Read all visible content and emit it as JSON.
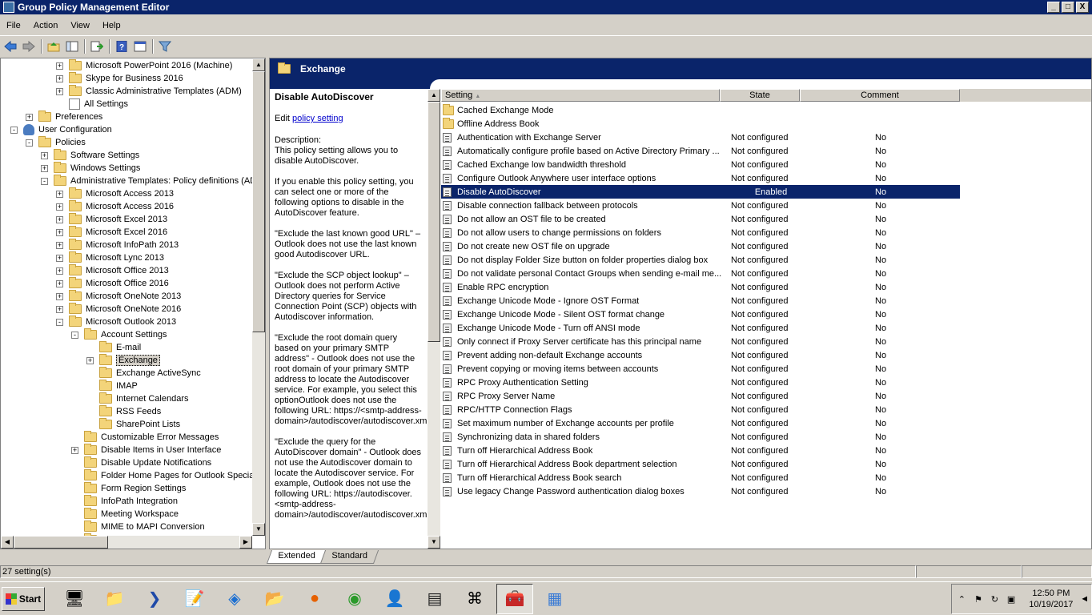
{
  "window": {
    "title": "Group Policy Management Editor",
    "min": "_",
    "max": "□",
    "close": "X"
  },
  "menu": [
    "File",
    "Action",
    "View",
    "Help"
  ],
  "toolbar": {
    "icons": [
      "back-arrow-icon",
      "forward-arrow-icon",
      "up-folder-icon",
      "show-hide-tree-icon",
      "export-list-icon",
      "help-icon",
      "properties-icon",
      "filter-icon"
    ]
  },
  "tree": [
    {
      "depth": 3,
      "exp": "+",
      "icon": "folder",
      "label": "Microsoft PowerPoint 2016 (Machine)"
    },
    {
      "depth": 3,
      "exp": "+",
      "icon": "folder",
      "label": "Skype for Business 2016"
    },
    {
      "depth": 3,
      "exp": "+",
      "icon": "folder",
      "label": "Classic Administrative Templates (ADM)"
    },
    {
      "depth": 3,
      "exp": "",
      "icon": "settings",
      "label": "All Settings"
    },
    {
      "depth": 1,
      "exp": "+",
      "icon": "folder",
      "label": "Preferences"
    },
    {
      "depth": 0,
      "exp": "-",
      "icon": "user",
      "label": "User Configuration"
    },
    {
      "depth": 1,
      "exp": "-",
      "icon": "folder",
      "label": "Policies"
    },
    {
      "depth": 2,
      "exp": "+",
      "icon": "folder",
      "label": "Software Settings"
    },
    {
      "depth": 2,
      "exp": "+",
      "icon": "folder",
      "label": "Windows Settings"
    },
    {
      "depth": 2,
      "exp": "-",
      "icon": "folder",
      "label": "Administrative Templates: Policy definitions (ADM"
    },
    {
      "depth": 3,
      "exp": "+",
      "icon": "folder",
      "label": "Microsoft Access 2013"
    },
    {
      "depth": 3,
      "exp": "+",
      "icon": "folder",
      "label": "Microsoft Access 2016"
    },
    {
      "depth": 3,
      "exp": "+",
      "icon": "folder",
      "label": "Microsoft Excel 2013"
    },
    {
      "depth": 3,
      "exp": "+",
      "icon": "folder",
      "label": "Microsoft Excel 2016"
    },
    {
      "depth": 3,
      "exp": "+",
      "icon": "folder",
      "label": "Microsoft InfoPath 2013"
    },
    {
      "depth": 3,
      "exp": "+",
      "icon": "folder",
      "label": "Microsoft Lync 2013"
    },
    {
      "depth": 3,
      "exp": "+",
      "icon": "folder",
      "label": "Microsoft Office 2013"
    },
    {
      "depth": 3,
      "exp": "+",
      "icon": "folder",
      "label": "Microsoft Office 2016"
    },
    {
      "depth": 3,
      "exp": "+",
      "icon": "folder",
      "label": "Microsoft OneNote 2013"
    },
    {
      "depth": 3,
      "exp": "+",
      "icon": "folder",
      "label": "Microsoft OneNote 2016"
    },
    {
      "depth": 3,
      "exp": "-",
      "icon": "folder",
      "label": "Microsoft Outlook 2013"
    },
    {
      "depth": 4,
      "exp": "-",
      "icon": "folder",
      "label": "Account Settings"
    },
    {
      "depth": 5,
      "exp": "",
      "icon": "folder",
      "label": "E-mail"
    },
    {
      "depth": 5,
      "exp": "+",
      "icon": "folder",
      "label": "Exchange",
      "selected": true
    },
    {
      "depth": 5,
      "exp": "",
      "icon": "folder",
      "label": "Exchange ActiveSync"
    },
    {
      "depth": 5,
      "exp": "",
      "icon": "folder",
      "label": "IMAP"
    },
    {
      "depth": 5,
      "exp": "",
      "icon": "folder",
      "label": "Internet Calendars"
    },
    {
      "depth": 5,
      "exp": "",
      "icon": "folder",
      "label": "RSS Feeds"
    },
    {
      "depth": 5,
      "exp": "",
      "icon": "folder",
      "label": "SharePoint Lists"
    },
    {
      "depth": 4,
      "exp": "",
      "icon": "folder",
      "label": "Customizable Error Messages"
    },
    {
      "depth": 4,
      "exp": "+",
      "icon": "folder",
      "label": "Disable Items in User Interface"
    },
    {
      "depth": 4,
      "exp": "",
      "icon": "folder",
      "label": "Disable Update Notifications"
    },
    {
      "depth": 4,
      "exp": "",
      "icon": "folder",
      "label": "Folder Home Pages for Outlook Special F"
    },
    {
      "depth": 4,
      "exp": "",
      "icon": "folder",
      "label": "Form Region Settings"
    },
    {
      "depth": 4,
      "exp": "",
      "icon": "folder",
      "label": "InfoPath Integration"
    },
    {
      "depth": 4,
      "exp": "",
      "icon": "folder",
      "label": "Meeting Workspace"
    },
    {
      "depth": 4,
      "exp": "",
      "icon": "folder",
      "label": "MIME to MAPI Conversion"
    },
    {
      "depth": 4,
      "exp": "+",
      "icon": "folder",
      "label": "Miscellaneous"
    }
  ],
  "right_header": {
    "title": "Exchange"
  },
  "description": {
    "title": "Disable AutoDiscover",
    "edit_prefix": "Edit ",
    "edit_link": "policy setting ",
    "paragraphs": [
      "Description:\nThis policy setting allows you to disable AutoDiscover.",
      "If you enable this policy setting, you can select one or more of the following options to disable in the AutoDiscover feature.",
      "\"Exclude the last known good URL\" – Outlook does not use the last known good Autodiscover URL.",
      "\"Exclude the SCP object lookup\" – Outlook does not perform Active Directory queries for Service Connection Point (SCP) objects with Autodiscover information.",
      "\"Exclude the root domain query based on your primary SMTP address\" - Outlook does not use the root domain of your primary SMTP address to locate the Autodiscover service. For example, you select this optionOutlook does not use the following URL: https://<smtp-address-domain>/autodiscover/autodiscover.xml.",
      "\"Exclude the query for the AutoDiscover domain\" - Outlook does not use the Autodiscover domain to locate the Autodiscover service. For example, Outlook does not use the following URL: https://autodiscover.<smtp-address-domain>/autodiscover/autodiscover.xml"
    ]
  },
  "list": {
    "columns": {
      "setting": "Setting",
      "state": "State",
      "comment": "Comment"
    },
    "rows": [
      {
        "type": "folder",
        "setting": "Cached Exchange Mode",
        "state": "",
        "comment": ""
      },
      {
        "type": "folder",
        "setting": "Offline Address Book",
        "state": "",
        "comment": ""
      },
      {
        "type": "policy",
        "setting": "Authentication with Exchange Server",
        "state": "Not configured",
        "comment": "No"
      },
      {
        "type": "policy",
        "setting": "Automatically configure profile based on Active Directory Primary ...",
        "state": "Not configured",
        "comment": "No"
      },
      {
        "type": "policy",
        "setting": "Cached Exchange low bandwidth threshold",
        "state": "Not configured",
        "comment": "No"
      },
      {
        "type": "policy",
        "setting": "Configure Outlook Anywhere user interface options",
        "state": "Not configured",
        "comment": "No"
      },
      {
        "type": "policy",
        "setting": "Disable AutoDiscover",
        "state": "Enabled",
        "comment": "No",
        "selected": true
      },
      {
        "type": "policy",
        "setting": "Disable connection fallback between protocols",
        "state": "Not configured",
        "comment": "No"
      },
      {
        "type": "policy",
        "setting": "Do not allow an OST file to be created",
        "state": "Not configured",
        "comment": "No"
      },
      {
        "type": "policy",
        "setting": "Do not allow users to change permissions on folders",
        "state": "Not configured",
        "comment": "No"
      },
      {
        "type": "policy",
        "setting": "Do not create new OST file on upgrade",
        "state": "Not configured",
        "comment": "No"
      },
      {
        "type": "policy",
        "setting": "Do not display Folder Size button on folder properties dialog box",
        "state": "Not configured",
        "comment": "No"
      },
      {
        "type": "policy",
        "setting": "Do not validate personal Contact Groups when sending e-mail me...",
        "state": "Not configured",
        "comment": "No"
      },
      {
        "type": "policy",
        "setting": "Enable RPC encryption",
        "state": "Not configured",
        "comment": "No"
      },
      {
        "type": "policy",
        "setting": "Exchange Unicode Mode - Ignore OST Format",
        "state": "Not configured",
        "comment": "No"
      },
      {
        "type": "policy",
        "setting": "Exchange Unicode Mode - Silent OST format change",
        "state": "Not configured",
        "comment": "No"
      },
      {
        "type": "policy",
        "setting": "Exchange Unicode Mode - Turn off ANSI mode",
        "state": "Not configured",
        "comment": "No"
      },
      {
        "type": "policy",
        "setting": "Only connect if Proxy Server certificate has this principal name",
        "state": "Not configured",
        "comment": "No"
      },
      {
        "type": "policy",
        "setting": "Prevent adding non-default Exchange accounts",
        "state": "Not configured",
        "comment": "No"
      },
      {
        "type": "policy",
        "setting": "Prevent copying or moving items between accounts",
        "state": "Not configured",
        "comment": "No"
      },
      {
        "type": "policy",
        "setting": "RPC Proxy Authentication Setting",
        "state": "Not configured",
        "comment": "No"
      },
      {
        "type": "policy",
        "setting": "RPC Proxy Server Name",
        "state": "Not configured",
        "comment": "No"
      },
      {
        "type": "policy",
        "setting": "RPC/HTTP Connection Flags",
        "state": "Not configured",
        "comment": "No"
      },
      {
        "type": "policy",
        "setting": "Set maximum number of Exchange accounts per profile",
        "state": "Not configured",
        "comment": "No"
      },
      {
        "type": "policy",
        "setting": "Synchronizing data in shared folders",
        "state": "Not configured",
        "comment": "No"
      },
      {
        "type": "policy",
        "setting": "Turn off Hierarchical Address Book",
        "state": "Not configured",
        "comment": "No"
      },
      {
        "type": "policy",
        "setting": "Turn off Hierarchical Address Book department selection",
        "state": "Not configured",
        "comment": "No"
      },
      {
        "type": "policy",
        "setting": "Turn off Hierarchical Address Book search",
        "state": "Not configured",
        "comment": "No"
      },
      {
        "type": "policy",
        "setting": "Use legacy Change Password authentication dialog boxes",
        "state": "Not configured",
        "comment": "No"
      }
    ]
  },
  "tabs": [
    {
      "label": "Extended",
      "active": true
    },
    {
      "label": "Standard",
      "active": false
    }
  ],
  "status": {
    "text": "27 setting(s)"
  },
  "taskbar": {
    "start_label": "Start",
    "apps": [
      "server-manager-icon",
      "explorer-icon",
      "powershell-icon",
      "notepad-icon",
      "app-icon",
      "folder-icon",
      "firefox-icon",
      "chrome-icon",
      "users-computers-icon",
      "cmd-icon",
      "network-icon",
      "group-policy-icon",
      "remote-desktop-icon"
    ],
    "active_app": 11,
    "clock_time": "12:50 PM",
    "clock_date": "10/19/2017"
  },
  "colors": {
    "selection": "#0a246a",
    "title_bar": "#0a246a",
    "window_bg": "#d4d0c8"
  }
}
